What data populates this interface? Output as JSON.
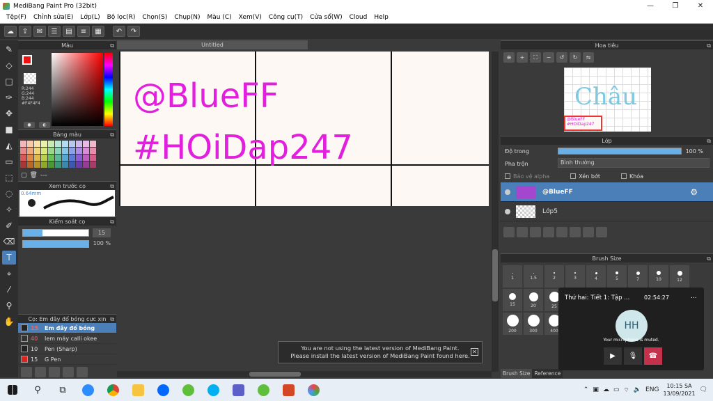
{
  "window": {
    "title": "MediBang Paint Pro (32bit)",
    "min": "—",
    "max": "❐",
    "close": "✕"
  },
  "menu": [
    "Tệp(F)",
    "Chỉnh sửa(E)",
    "Lớp(L)",
    "Bộ lọc(R)",
    "Chọn(S)",
    "Chụp(N)",
    "Màu (C)",
    "Xem(V)",
    "Công cụ(T)",
    "Cửa sổ(W)",
    "Cloud",
    "Help"
  ],
  "color_panel": {
    "title": "Màu",
    "r": "R:244",
    "g": "G:244",
    "b": "B:244",
    "hex": "#F4F4F4",
    "fg": "#ee1111",
    "bg": "#f4f4f4"
  },
  "palette_panel": {
    "title": "Bảng màu",
    "label": "---",
    "colors": [
      "#f4b6b6",
      "#f7c9a8",
      "#f8e2a6",
      "#eaf2a8",
      "#c8ecb0",
      "#b6e6d4",
      "#b2dcef",
      "#b8c6f0",
      "#cdb8f0",
      "#e8b8e8",
      "#f0b8cc",
      "#e88888",
      "#f0a878",
      "#f0d478",
      "#d8e878",
      "#98d888",
      "#88d4b8",
      "#84c4e4",
      "#8ca0e8",
      "#ac8ce8",
      "#d88cd8",
      "#e88cac",
      "#d85858",
      "#e08848",
      "#e0b848",
      "#b8d048",
      "#68c058",
      "#58b898",
      "#54a8d4",
      "#5c78d8",
      "#8c5cd8",
      "#c05cc0",
      "#d85c88",
      "#a83838",
      "#b86828",
      "#b89028",
      "#90a828",
      "#489838",
      "#389878",
      "#3888b0",
      "#3c58b0",
      "#6c3cb0",
      "#983c98",
      "#a83c68"
    ]
  },
  "brush_preview": {
    "title": "Xem trước cọ",
    "size": "0.64mm"
  },
  "brush_control": {
    "title": "Kiểm soát cọ",
    "size_value": "15",
    "size_fill": 0.3,
    "opacity_value": "100 %",
    "opacity_fill": 1.0
  },
  "brush_list": {
    "title": "Cọ: Em đây đổ bóng cực xịn",
    "items": [
      {
        "num": "15",
        "name": "Em đây đổ bóng",
        "color": "#222222",
        "active": true
      },
      {
        "num": "40",
        "name": "Iem máy calli okee",
        "color": "#333333",
        "active": false
      },
      {
        "num": "10",
        "name": "Pen (Sharp)",
        "color": "#222222",
        "active": false
      },
      {
        "num": "15",
        "name": "G Pen",
        "color": "#dd2222",
        "active": false
      }
    ]
  },
  "canvas": {
    "tab": "Untitled",
    "line1": "@BlueFF",
    "line2": "#HOiDap247",
    "text_color": "#e21fdd"
  },
  "notice": {
    "line1": "You are not using the latest version of MediBang Paint.",
    "line2": "Please install the latest version of MediBang Paint found here.",
    "close": "✕"
  },
  "navigator": {
    "title": "Hoa tiêu",
    "preview_text": "Châu",
    "mini1": "@BlueFF",
    "mini2": "#HOiDap247"
  },
  "layer_panel": {
    "title": "Lớp",
    "opacity_label": "Độ trong",
    "opacity_value": "100 %",
    "blend_label": "Pha trộn",
    "blend_value": "Bình thường",
    "protect_alpha": "Bảo vệ alpha",
    "clipping": "Xén bớt",
    "lock": "Khóa",
    "layers": [
      {
        "name": "@BlueFF",
        "active": true
      },
      {
        "name": "Lớp5",
        "active": false
      }
    ]
  },
  "brush_size": {
    "title": "Brush Size",
    "cells": [
      {
        "label": "1",
        "d": 1
      },
      {
        "label": "1.5",
        "d": 1
      },
      {
        "label": "2",
        "d": 2
      },
      {
        "label": "3",
        "d": 2
      },
      {
        "label": "4",
        "d": 3
      },
      {
        "label": "5",
        "d": 4
      },
      {
        "label": "7",
        "d": 5
      },
      {
        "label": "10",
        "d": 6
      },
      {
        "label": "12",
        "d": 7
      },
      {
        "label": "15",
        "d": 10
      },
      {
        "label": "20",
        "d": 13
      },
      {
        "label": "25",
        "d": 15
      },
      {
        "label": "",
        "d": 0
      },
      {
        "label": "",
        "d": 0
      },
      {
        "label": "",
        "d": 0
      },
      {
        "label": "",
        "d": 0
      },
      {
        "label": "",
        "d": 0
      },
      {
        "label": "",
        "d": 0
      },
      {
        "label": "200",
        "d": 17
      },
      {
        "label": "300",
        "d": 17
      },
      {
        "label": "400",
        "d": 17
      }
    ],
    "tab1": "Brush Size",
    "tab2": "Reference"
  },
  "call": {
    "title": "Thứ hai: Tiết 1: Tập ...",
    "time": "02:54:27",
    "initials": "HH",
    "muted": "Your microphone is muted.",
    "more": "..."
  },
  "taskbar": {
    "lang": "ENG",
    "time": "10:15 SA",
    "date": "13/09/2021"
  }
}
